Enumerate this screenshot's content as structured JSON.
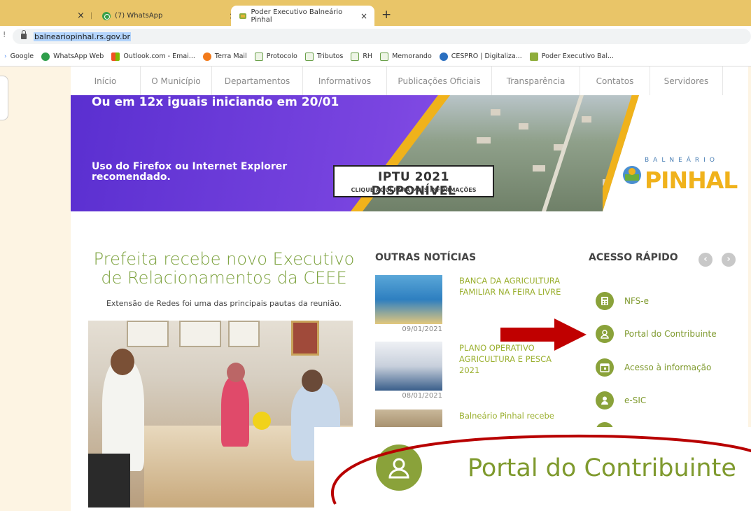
{
  "browser": {
    "tabs": [
      {
        "label": "",
        "close": "×"
      },
      {
        "label": "(7) WhatsApp",
        "close": "×"
      },
      {
        "label": "Poder Executivo Balneário Pinhal",
        "close": "×"
      }
    ],
    "new_tab": "+",
    "url": "balneariopinhal.rs.gov.br",
    "bookmarks": [
      {
        "label": "Google",
        "icon": "google-icon"
      },
      {
        "label": "WhatsApp Web",
        "icon": "whatsapp-icon"
      },
      {
        "label": "Outlook.com - Emai...",
        "icon": "outlook-icon"
      },
      {
        "label": "Terra Mail",
        "icon": "terra-icon"
      },
      {
        "label": "Protocolo",
        "icon": "folder-icon"
      },
      {
        "label": "Tributos",
        "icon": "folder-icon"
      },
      {
        "label": "RH",
        "icon": "folder-icon"
      },
      {
        "label": "Memorando",
        "icon": "folder-icon"
      },
      {
        "label": "CESPRO | Digitaliza...",
        "icon": "cespro-icon"
      },
      {
        "label": "Poder Executivo Bal...",
        "icon": "crest-icon"
      }
    ]
  },
  "nav": [
    "Início",
    "O Município",
    "Departamentos",
    "Informativos",
    "Publicações Oficiais",
    "Transparência",
    "Contatos",
    "Servidores"
  ],
  "banner": {
    "top_text": "Ou em 12x iguais iniciando em 20/01",
    "browser_line1": "Uso do Firefox ou Internet Explorer",
    "browser_line2": "recomendado.",
    "iptu_title": "IPTU 2021 DISPONÍVEL",
    "iptu_sub": "CLIQUE AQUI PARA MAIS INFORMAÇÕES",
    "logo_top": "BALNEÁRIO",
    "logo_main": "PINHAL"
  },
  "main_story": {
    "headline_line1": "Prefeita recebe novo Executivo",
    "headline_line2": "de Relacionamentos da CEEE",
    "subhead": "Extensão de Redes foi uma das principais pautas da reunião."
  },
  "news": {
    "title": "OUTRAS NOTÍCIAS",
    "items": [
      {
        "title": "BANCA DA AGRICULTURA FAMILIAR NA FEIRA LIVRE",
        "date": "09/01/2021"
      },
      {
        "title": "PLANO OPERATIVO AGRICULTURA E PESCA 2021",
        "date": "08/01/2021"
      },
      {
        "title": "Balneário Pinhal recebe",
        "date": ""
      }
    ]
  },
  "quick_access": {
    "title": "ACESSO RÁPIDO",
    "prev": "‹",
    "next": "›",
    "items": [
      {
        "label": "NFS-e",
        "icon": "calculator-icon"
      },
      {
        "label": "Portal do Contribuinte",
        "icon": "user-icon"
      },
      {
        "label": "Acesso à informação",
        "icon": "calendar-icon"
      },
      {
        "label": "e-SIC",
        "icon": "person-icon"
      }
    ]
  },
  "zoom": {
    "label": "Portal do Contribuinte",
    "icon": "user-icon"
  },
  "colors": {
    "tabbar": "#e9c568",
    "green": "#8aa23a",
    "link_green": "#9bb030",
    "annotation_red": "#c00000",
    "banner_purple": "#6b3bd1",
    "banner_yellow": "#f0b21b"
  }
}
